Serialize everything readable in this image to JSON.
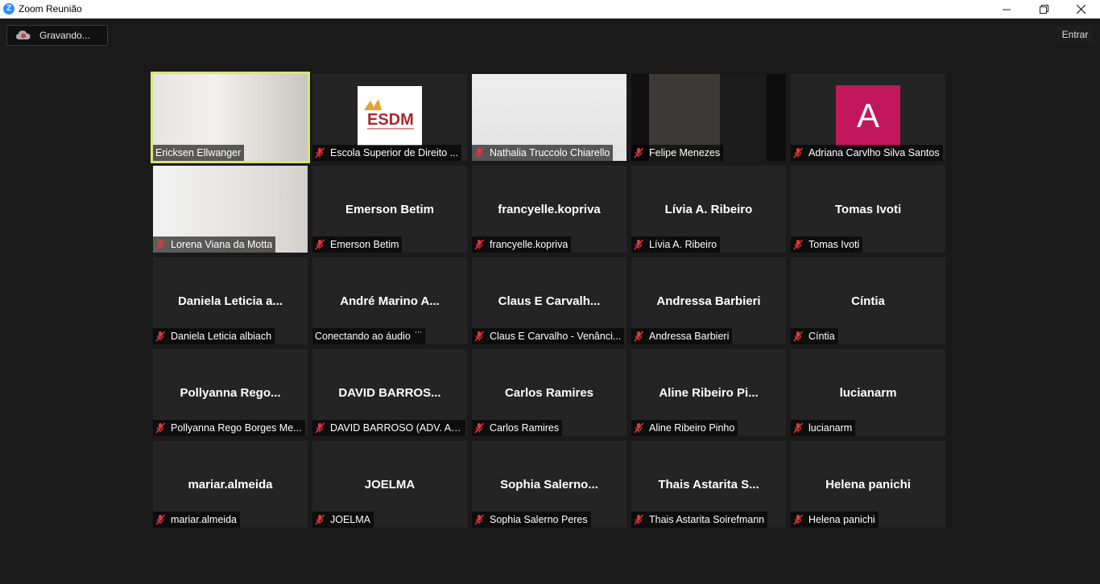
{
  "window": {
    "title": "Zoom Reunião",
    "minimize_icon": "minimize-icon",
    "restore_icon": "restore-icon",
    "close_icon": "close-icon"
  },
  "recording": {
    "label": "Gravando...",
    "icon": "record-cloud-icon"
  },
  "enter_button": {
    "label": "Entrar"
  },
  "colors": {
    "active_speaker_border": "#d7e47a",
    "mute_icon": "#e0383e",
    "avatar_a": "#c2185b",
    "background": "#1a1a1a",
    "tile": "#242424"
  },
  "participants": [
    {
      "display": "",
      "name": "Ericksen Ellwanger",
      "muted": false,
      "active": true,
      "media": "video"
    },
    {
      "display": "",
      "name": "Escola Superior de Direito ...",
      "muted": true,
      "media": "logo",
      "logo_text": "ESDM"
    },
    {
      "display": "",
      "name": "Nathalia Truccolo Chiarello",
      "muted": true,
      "media": "video"
    },
    {
      "display": "",
      "name": "Felipe Menezes",
      "muted": true,
      "media": "video"
    },
    {
      "display": "",
      "name": "Adriana Carvlho Silva Santos",
      "muted": true,
      "media": "avatar",
      "avatar_letter": "A"
    },
    {
      "display": "",
      "name": "Lorena Viana da Motta",
      "muted": true,
      "media": "video"
    },
    {
      "display": "Emerson Betim",
      "name": "Emerson Betim",
      "muted": true
    },
    {
      "display": "francyelle.kopriva",
      "name": "francyelle.kopriva",
      "muted": true
    },
    {
      "display": "Lívia A. Ribeiro",
      "name": "Lívia A. Ribeiro",
      "muted": true
    },
    {
      "display": "Tomas Ivoti",
      "name": "Tomas Ivoti",
      "muted": true
    },
    {
      "display": "Daniela Leticia a...",
      "name": "Daniela Leticia albiach",
      "muted": true
    },
    {
      "display": "André Marino A...",
      "name": "Conectando ao áudio",
      "muted": false,
      "connecting": true
    },
    {
      "display": "Claus E Carvalh...",
      "name": "Claus E Carvalho - Venânci...",
      "muted": true
    },
    {
      "display": "Andressa Barbieri",
      "name": "Andressa Barbieri",
      "muted": true
    },
    {
      "display": "Cíntia",
      "name": "Cíntia",
      "muted": true
    },
    {
      "display": "Pollyanna Rego...",
      "name": "Pollyanna Rego Borges Me...",
      "muted": true
    },
    {
      "display": "DAVID BARROS...",
      "name": "DAVID BARROSO (ADV. AR...",
      "muted": true
    },
    {
      "display": "Carlos Ramires",
      "name": "Carlos Ramires",
      "muted": true
    },
    {
      "display": "Aline Ribeiro Pi...",
      "name": "Aline Ribeiro Pinho",
      "muted": true
    },
    {
      "display": "lucianarm",
      "name": "lucianarm",
      "muted": true
    },
    {
      "display": "mariar.almeida",
      "name": "mariar.almeida",
      "muted": true
    },
    {
      "display": "JOELMA",
      "name": "JOELMA",
      "muted": true
    },
    {
      "display": "Sophia Salerno...",
      "name": "Sophia Salerno Peres",
      "muted": true
    },
    {
      "display": "Thais Astarita S...",
      "name": "Thais Astarita Soirefmann",
      "muted": true
    },
    {
      "display": "Helena panichi",
      "name": "Helena panichi",
      "muted": true
    }
  ]
}
